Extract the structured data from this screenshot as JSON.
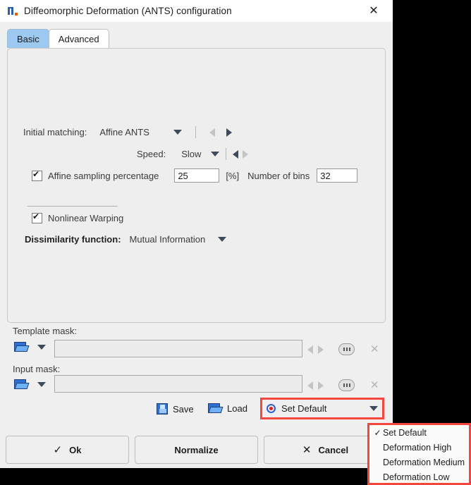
{
  "window": {
    "title": "Diffeomorphic Deformation (ANTS) configuration",
    "icon": "app-icon",
    "close_label": "✕"
  },
  "tabs": [
    {
      "label": "Basic",
      "active": true
    },
    {
      "label": "Advanced",
      "active": false
    }
  ],
  "basic": {
    "initial_matching": {
      "label": "Initial matching:",
      "value": "Affine ANTS",
      "prev_enabled": false,
      "next_enabled": true
    },
    "speed": {
      "label": "Speed:",
      "value": "Slow",
      "prev_enabled": true,
      "next_enabled": false
    },
    "affine_sampling": {
      "label": "Affine sampling percentage",
      "checked": true,
      "value": "25",
      "unit": "[%]"
    },
    "number_of_bins": {
      "label": "Number of bins",
      "value": "32"
    },
    "nonlinear_warping": {
      "label": "Nonlinear Warping",
      "checked": true
    },
    "dissimilarity": {
      "label": "Dissimilarity function:",
      "value": "Mutual Information"
    }
  },
  "masks": {
    "template": {
      "label": "Template mask:",
      "value": "",
      "browse_icon": "folder-open-icon",
      "more_icon": "ellipsis-icon",
      "clear_icon": "close-icon"
    },
    "input": {
      "label": "Input mask:",
      "value": "",
      "browse_icon": "folder-open-icon",
      "more_icon": "ellipsis-icon",
      "clear_icon": "close-icon"
    }
  },
  "toolbar": {
    "save_label": "Save",
    "save_icon": "floppy-disk-icon",
    "load_label": "Load",
    "load_icon": "folder-open-icon",
    "set_default_label": "Set Default",
    "set_default_icon": "target-icon"
  },
  "menu": {
    "items": [
      {
        "label": "Set Default",
        "checked": true
      },
      {
        "label": "Deformation High",
        "checked": false
      },
      {
        "label": "Deformation Medium",
        "checked": false
      },
      {
        "label": "Deformation Low",
        "checked": false
      }
    ],
    "check_glyph": "✓"
  },
  "actions": [
    {
      "label": "Ok",
      "icon": "check-icon",
      "glyph": "✓"
    },
    {
      "label": "Normalize",
      "icon": "",
      "glyph": ""
    },
    {
      "label": "Cancel",
      "icon": "close-icon",
      "glyph": "✕"
    }
  ],
  "highlight_color": "#f4463c"
}
